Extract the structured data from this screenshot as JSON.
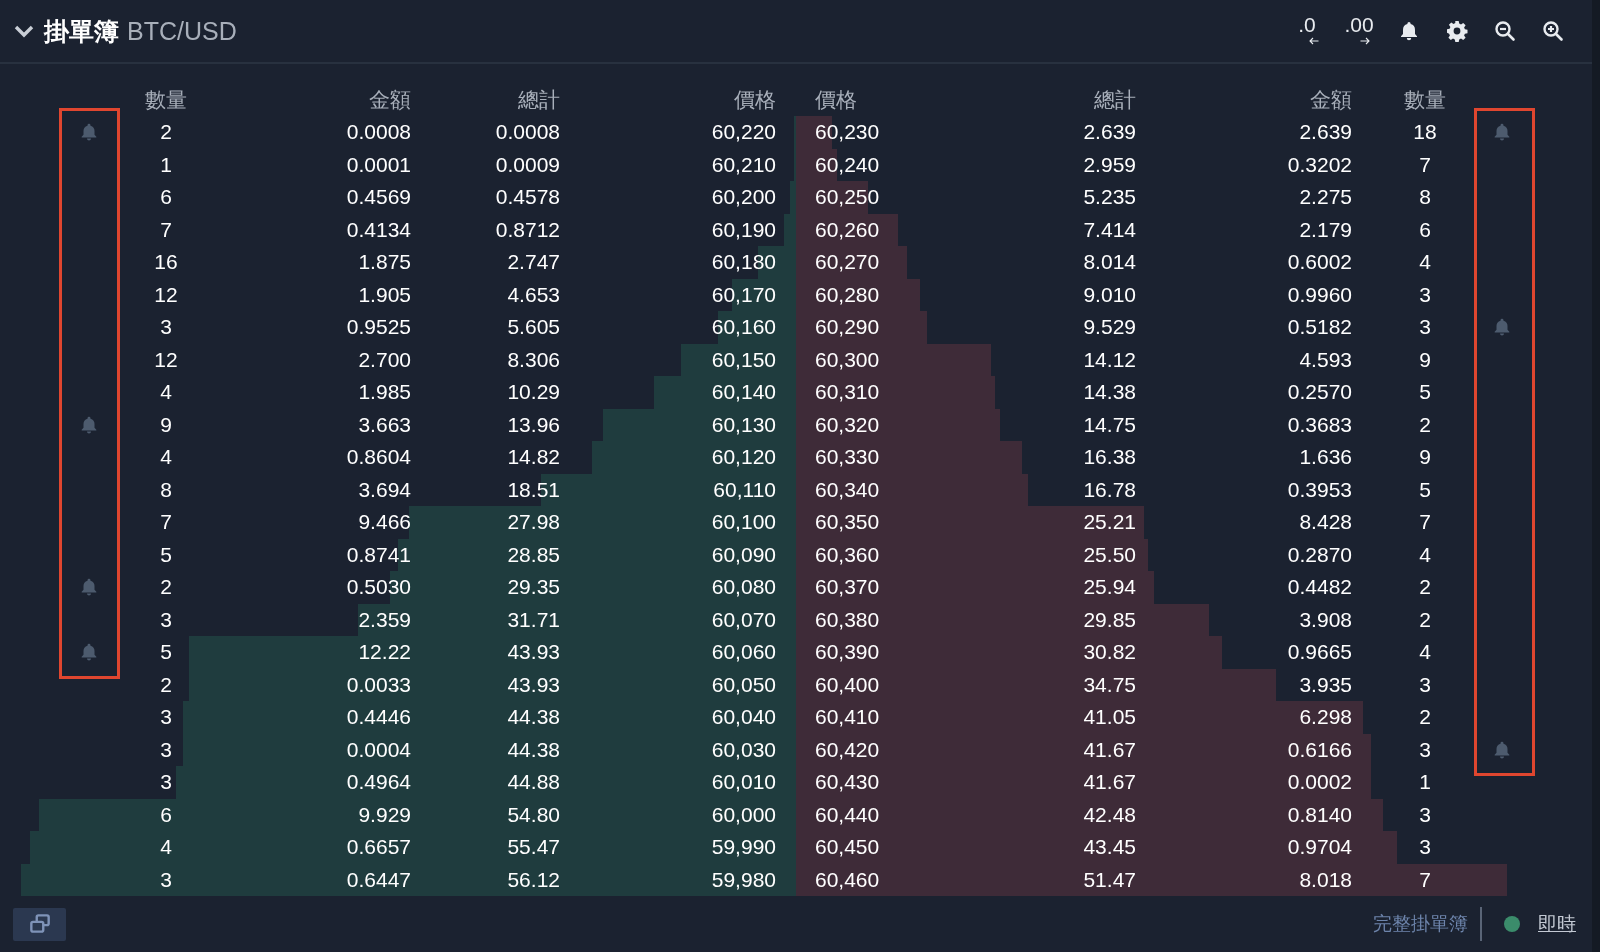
{
  "header": {
    "title": "掛單簿",
    "pair": "BTC/USD",
    "expanded": true,
    "tools": [
      {
        "kind": "decimals-less",
        "label": ".0"
      },
      {
        "kind": "decimals-more",
        "label": ".00"
      },
      {
        "kind": "bell"
      },
      {
        "kind": "settings"
      },
      {
        "kind": "zoom-out"
      },
      {
        "kind": "zoom-in"
      }
    ]
  },
  "columns": {
    "bids": [
      "數量",
      "金額",
      "總計",
      "價格"
    ],
    "asks": [
      "價格",
      "總計",
      "金額",
      "數量"
    ]
  },
  "rows": [
    {
      "bid": {
        "qty": "2",
        "amount": "0.0008",
        "total": "0.0008",
        "price": "60,220",
        "level": 0.002,
        "alert": true,
        "framed": true
      },
      "ask": {
        "price": "60,230",
        "total": "2.639",
        "amount": "2.639",
        "qty": "18",
        "level": 0.046,
        "alert": true,
        "framed": true
      }
    },
    {
      "bid": {
        "qty": "1",
        "amount": "0.0001",
        "total": "0.0009",
        "price": "60,210",
        "level": 0.002,
        "alert": false,
        "framed": true
      },
      "ask": {
        "price": "60,240",
        "total": "2.959",
        "amount": "0.3202",
        "qty": "7",
        "level": 0.052,
        "alert": false,
        "framed": true
      }
    },
    {
      "bid": {
        "qty": "6",
        "amount": "0.4569",
        "total": "0.4578",
        "price": "60,200",
        "level": 0.008,
        "alert": false,
        "framed": true
      },
      "ask": {
        "price": "60,250",
        "total": "5.235",
        "amount": "2.275",
        "qty": "8",
        "level": 0.092,
        "alert": false,
        "framed": true
      }
    },
    {
      "bid": {
        "qty": "7",
        "amount": "0.4134",
        "total": "0.8712",
        "price": "60,190",
        "level": 0.015,
        "alert": false,
        "framed": true
      },
      "ask": {
        "price": "60,260",
        "total": "7.414",
        "amount": "2.179",
        "qty": "6",
        "level": 0.13,
        "alert": false,
        "framed": true
      }
    },
    {
      "bid": {
        "qty": "16",
        "amount": "1.875",
        "total": "2.747",
        "price": "60,180",
        "level": 0.048,
        "alert": false,
        "framed": true
      },
      "ask": {
        "price": "60,270",
        "total": "8.014",
        "amount": "0.6002",
        "qty": "4",
        "level": 0.141,
        "alert": false,
        "framed": true
      }
    },
    {
      "bid": {
        "qty": "12",
        "amount": "1.905",
        "total": "4.653",
        "price": "60,170",
        "level": 0.082,
        "alert": false,
        "framed": true
      },
      "ask": {
        "price": "60,280",
        "total": "9.010",
        "amount": "0.9960",
        "qty": "3",
        "level": 0.158,
        "alert": false,
        "framed": true
      }
    },
    {
      "bid": {
        "qty": "3",
        "amount": "0.9525",
        "total": "5.605",
        "price": "60,160",
        "level": 0.099,
        "alert": false,
        "framed": true
      },
      "ask": {
        "price": "60,290",
        "total": "9.529",
        "amount": "0.5182",
        "qty": "3",
        "level": 0.167,
        "alert": true,
        "framed": true
      }
    },
    {
      "bid": {
        "qty": "12",
        "amount": "2.700",
        "total": "8.306",
        "price": "60,150",
        "level": 0.146,
        "alert": false,
        "framed": true
      },
      "ask": {
        "price": "60,300",
        "total": "14.12",
        "amount": "4.593",
        "qty": "9",
        "level": 0.248,
        "alert": false,
        "framed": true
      }
    },
    {
      "bid": {
        "qty": "4",
        "amount": "1.985",
        "total": "10.29",
        "price": "60,140",
        "level": 0.181,
        "alert": false,
        "framed": true
      },
      "ask": {
        "price": "60,310",
        "total": "14.38",
        "amount": "0.2570",
        "qty": "5",
        "level": 0.253,
        "alert": false,
        "framed": true
      }
    },
    {
      "bid": {
        "qty": "9",
        "amount": "3.663",
        "total": "13.96",
        "price": "60,130",
        "level": 0.245,
        "alert": true,
        "framed": true
      },
      "ask": {
        "price": "60,320",
        "total": "14.75",
        "amount": "0.3683",
        "qty": "2",
        "level": 0.259,
        "alert": false,
        "framed": true
      }
    },
    {
      "bid": {
        "qty": "4",
        "amount": "0.8604",
        "total": "14.82",
        "price": "60,120",
        "level": 0.26,
        "alert": false,
        "framed": true
      },
      "ask": {
        "price": "60,330",
        "total": "16.38",
        "amount": "1.636",
        "qty": "9",
        "level": 0.288,
        "alert": false,
        "framed": true
      }
    },
    {
      "bid": {
        "qty": "8",
        "amount": "3.694",
        "total": "18.51",
        "price": "60,110",
        "level": 0.325,
        "alert": false,
        "framed": true
      },
      "ask": {
        "price": "60,340",
        "total": "16.78",
        "amount": "0.3953",
        "qty": "5",
        "level": 0.295,
        "alert": false,
        "framed": true
      }
    },
    {
      "bid": {
        "qty": "7",
        "amount": "9.466",
        "total": "27.98",
        "price": "60,100",
        "level": 0.492,
        "alert": false,
        "framed": true
      },
      "ask": {
        "price": "60,350",
        "total": "25.21",
        "amount": "8.428",
        "qty": "7",
        "level": 0.443,
        "alert": false,
        "framed": true
      }
    },
    {
      "bid": {
        "qty": "5",
        "amount": "0.8741",
        "total": "28.85",
        "price": "60,090",
        "level": 0.507,
        "alert": false,
        "framed": true
      },
      "ask": {
        "price": "60,360",
        "total": "25.50",
        "amount": "0.2870",
        "qty": "4",
        "level": 0.448,
        "alert": false,
        "framed": true
      }
    },
    {
      "bid": {
        "qty": "2",
        "amount": "0.5030",
        "total": "29.35",
        "price": "60,080",
        "level": 0.516,
        "alert": true,
        "framed": true
      },
      "ask": {
        "price": "60,370",
        "total": "25.94",
        "amount": "0.4482",
        "qty": "2",
        "level": 0.456,
        "alert": false,
        "framed": true
      }
    },
    {
      "bid": {
        "qty": "3",
        "amount": "2.359",
        "total": "31.71",
        "price": "60,070",
        "level": 0.557,
        "alert": false,
        "framed": true
      },
      "ask": {
        "price": "60,380",
        "total": "29.85",
        "amount": "3.908",
        "qty": "2",
        "level": 0.525,
        "alert": false,
        "framed": true
      }
    },
    {
      "bid": {
        "qty": "5",
        "amount": "12.22",
        "total": "43.93",
        "price": "60,060",
        "level": 0.772,
        "alert": true,
        "framed": true
      },
      "ask": {
        "price": "60,390",
        "total": "30.82",
        "amount": "0.9665",
        "qty": "4",
        "level": 0.542,
        "alert": false,
        "framed": true
      }
    },
    {
      "bid": {
        "qty": "2",
        "amount": "0.0033",
        "total": "43.93",
        "price": "60,050",
        "level": 0.772,
        "alert": false,
        "framed": false
      },
      "ask": {
        "price": "60,400",
        "total": "34.75",
        "amount": "3.935",
        "qty": "3",
        "level": 0.611,
        "alert": false,
        "framed": true
      }
    },
    {
      "bid": {
        "qty": "3",
        "amount": "0.4446",
        "total": "44.38",
        "price": "60,040",
        "level": 0.78,
        "alert": false,
        "framed": false
      },
      "ask": {
        "price": "60,410",
        "total": "41.05",
        "amount": "6.298",
        "qty": "2",
        "level": 0.721,
        "alert": false,
        "framed": true
      }
    },
    {
      "bid": {
        "qty": "3",
        "amount": "0.0004",
        "total": "44.38",
        "price": "60,030",
        "level": 0.78,
        "alert": false,
        "framed": false
      },
      "ask": {
        "price": "60,420",
        "total": "41.67",
        "amount": "0.6166",
        "qty": "3",
        "level": 0.732,
        "alert": true,
        "framed": true
      }
    },
    {
      "bid": {
        "qty": "3",
        "amount": "0.4964",
        "total": "44.88",
        "price": "60,010",
        "level": 0.789,
        "alert": false,
        "framed": false
      },
      "ask": {
        "price": "60,430",
        "total": "41.67",
        "amount": "0.0002",
        "qty": "1",
        "level": 0.732,
        "alert": false,
        "framed": false
      }
    },
    {
      "bid": {
        "qty": "6",
        "amount": "9.929",
        "total": "54.80",
        "price": "60,000",
        "level": 0.963,
        "alert": false,
        "framed": false
      },
      "ask": {
        "price": "60,440",
        "total": "42.48",
        "amount": "0.8140",
        "qty": "3",
        "level": 0.747,
        "alert": false,
        "framed": false
      }
    },
    {
      "bid": {
        "qty": "4",
        "amount": "0.6657",
        "total": "55.47",
        "price": "59,990",
        "level": 0.975,
        "alert": false,
        "framed": false
      },
      "ask": {
        "price": "60,450",
        "total": "43.45",
        "amount": "0.9704",
        "qty": "3",
        "level": 0.764,
        "alert": false,
        "framed": false
      }
    },
    {
      "bid": {
        "qty": "3",
        "amount": "0.6447",
        "total": "56.12",
        "price": "59,980",
        "level": 0.986,
        "alert": false,
        "framed": false
      },
      "ask": {
        "price": "60,460",
        "total": "51.47",
        "amount": "8.018",
        "qty": "7",
        "level": 0.905,
        "alert": false,
        "framed": false
      }
    }
  ],
  "footer": {
    "full_book_link": "完整掛單簿",
    "live": {
      "label": "即時",
      "connected": true
    }
  }
}
